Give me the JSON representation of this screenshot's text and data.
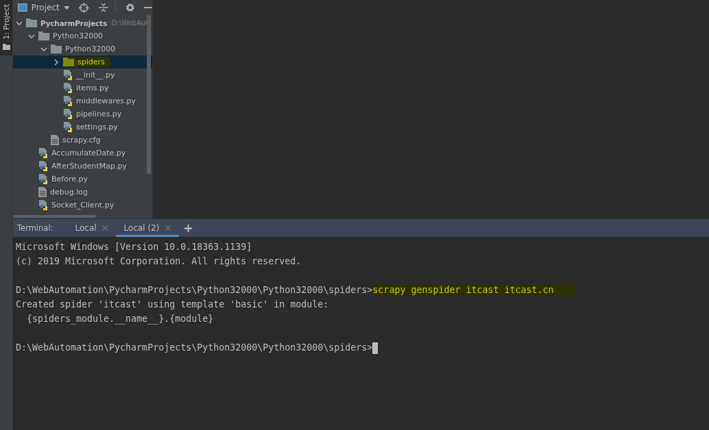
{
  "side_stripe": {
    "label": "1: Project"
  },
  "project_panel": {
    "title": "Project",
    "tree": [
      {
        "name": "PycharmProjects",
        "path": "D:\\WebAut",
        "kind": "folder",
        "expanded": true,
        "selected": false,
        "children": [
          {
            "name": "Python32000",
            "kind": "folder",
            "expanded": true,
            "selected": false,
            "children": [
              {
                "name": "Python32000",
                "kind": "folder",
                "expanded": true,
                "selected": false,
                "children": [
                  {
                    "name": "spiders",
                    "kind": "folder",
                    "expanded": false,
                    "selected": true
                  },
                  {
                    "name": "__init__.py",
                    "kind": "python",
                    "selected": false
                  },
                  {
                    "name": "items.py",
                    "kind": "python",
                    "selected": false
                  },
                  {
                    "name": "middlewares.py",
                    "kind": "python",
                    "selected": false
                  },
                  {
                    "name": "pipelines.py",
                    "kind": "python",
                    "selected": false
                  },
                  {
                    "name": "settings.py",
                    "kind": "python",
                    "selected": false
                  }
                ]
              },
              {
                "name": "scrapy.cfg",
                "kind": "file",
                "selected": false
              }
            ]
          },
          {
            "name": "AccumulateDate.py",
            "kind": "python",
            "selected": false
          },
          {
            "name": "AfterStudentMap.py",
            "kind": "python",
            "selected": false
          },
          {
            "name": "Before.py",
            "kind": "python",
            "selected": false
          },
          {
            "name": "debug.log",
            "kind": "file",
            "selected": false
          },
          {
            "name": "Socket_Client.py",
            "kind": "python",
            "selected": false
          }
        ]
      }
    ]
  },
  "terminal": {
    "label": "Terminal:",
    "tabs": [
      {
        "label": "Local",
        "selected": false
      },
      {
        "label": "Local (2)",
        "selected": true
      }
    ],
    "lines": [
      {
        "kind": "output",
        "text": "Microsoft Windows [Version 10.0.18363.1139]"
      },
      {
        "kind": "output",
        "text": "(c) 2019 Microsoft Corporation. All rights reserved."
      },
      {
        "kind": "blank"
      },
      {
        "kind": "prompt",
        "text": "D:\\WebAutomation\\PycharmProjects\\Python32000\\Python32000\\spiders>",
        "command": "scrapy genspider itcast itcast.cn"
      },
      {
        "kind": "output",
        "text": "Created spider 'itcast' using template 'basic' in module:"
      },
      {
        "kind": "output",
        "text": "  {spiders_module.__name__}.{module}"
      },
      {
        "kind": "blank"
      },
      {
        "kind": "prompt",
        "text": "D:\\WebAutomation\\PycharmProjects\\Python32000\\Python32000\\spiders>",
        "cursor": true
      }
    ]
  }
}
